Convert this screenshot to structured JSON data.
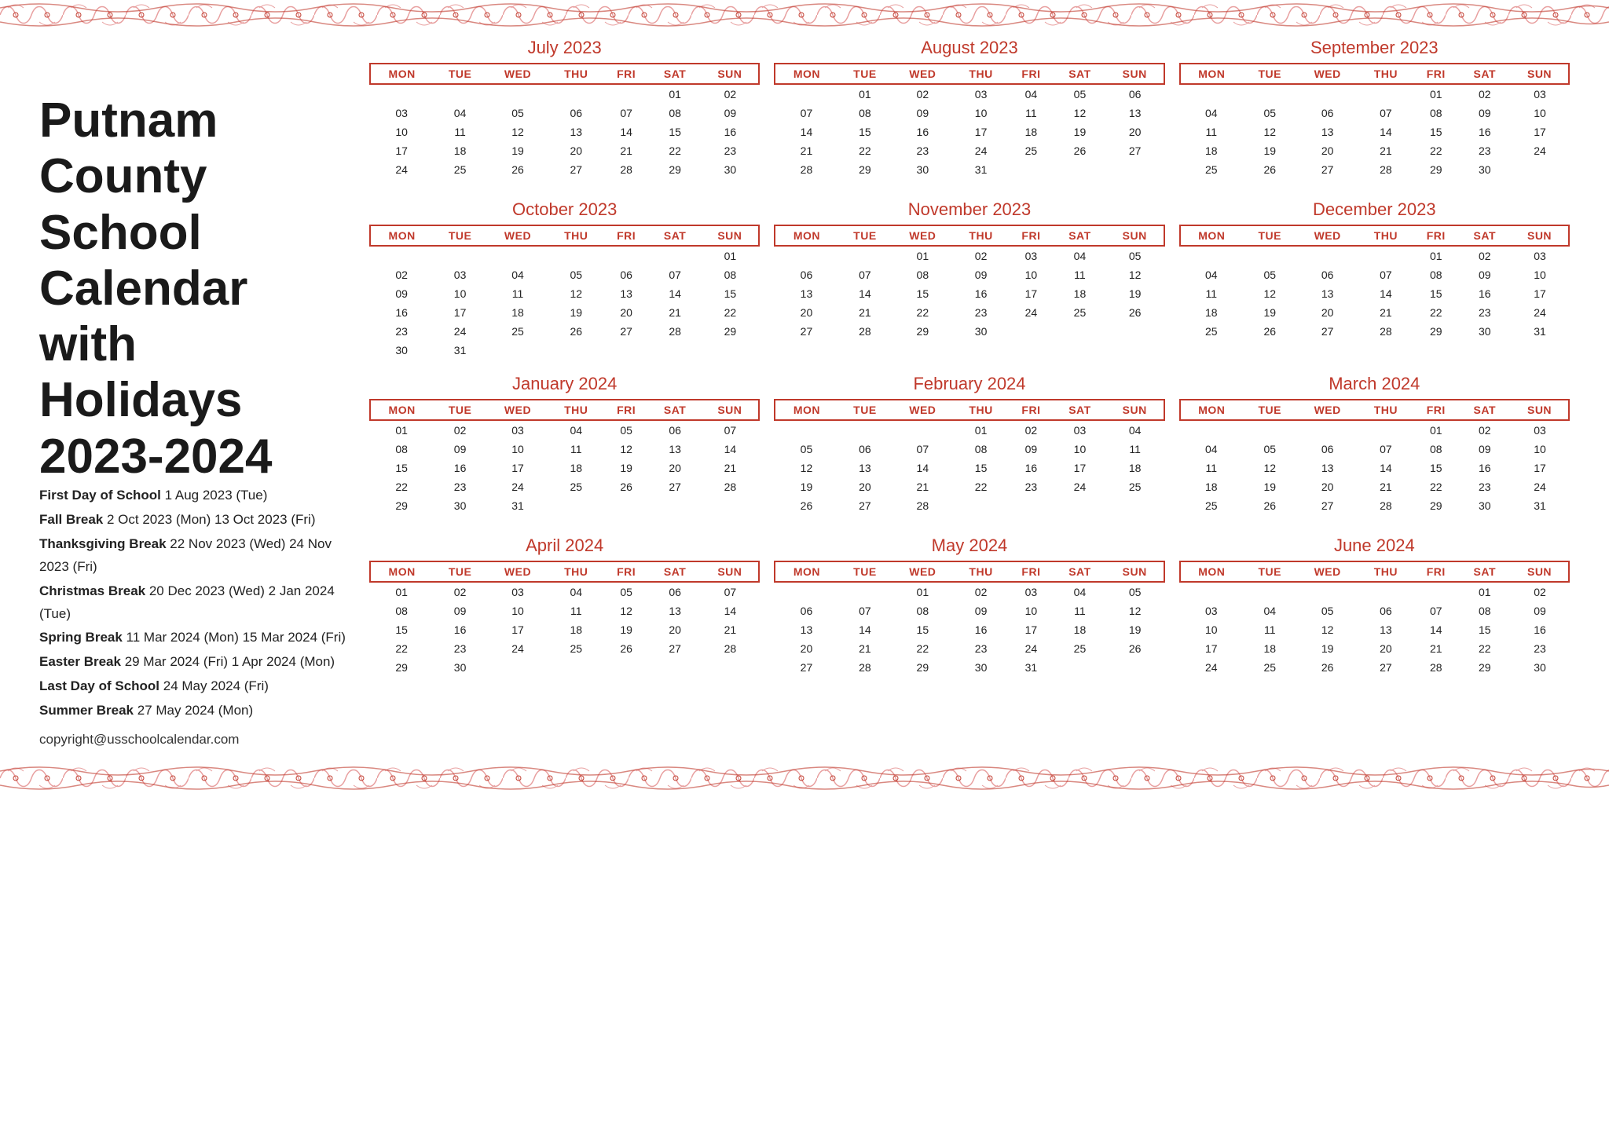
{
  "title": "Putnam County\nSchool Calendar\nwith Holidays\n2023-2024",
  "copyright": "copyright@usschoolcalendar.com",
  "holidays": [
    {
      "label": "First Day of School",
      "value": "1 Aug 2023 (Tue)"
    },
    {
      "label": "Fall Break",
      "value": "2 Oct 2023 (Mon)    13 Oct 2023 (Fri)"
    },
    {
      "label": "Thanksgiving Break",
      "value": "22 Nov 2023 (Wed) 24 Nov 2023 (Fri)"
    },
    {
      "label": "Christmas Break",
      "value": "20 Dec 2023 (Wed) 2 Jan 2024 (Tue)"
    },
    {
      "label": "Spring Break",
      "value": "11 Mar 2024 (Mon) 15 Mar 2024 (Fri)"
    },
    {
      "label": "Easter Break",
      "value": "29 Mar 2024 (Fri)    1 Apr 2024 (Mon)"
    },
    {
      "label": "Last Day of School",
      "value": "24 May 2024 (Fri)"
    },
    {
      "label": "Summer Break",
      "value": "27 May 2024 (Mon)"
    }
  ],
  "months": [
    {
      "name": "July 2023",
      "days": [
        "MON",
        "TUE",
        "WED",
        "THU",
        "FRI",
        "SAT",
        "SUN"
      ],
      "weeks": [
        [
          "",
          "",
          "",
          "",
          "",
          "01",
          "02"
        ],
        [
          "03",
          "04",
          "05",
          "06",
          "07",
          "08",
          "09"
        ],
        [
          "10",
          "11",
          "12",
          "13",
          "14",
          "15",
          "16"
        ],
        [
          "17",
          "18",
          "19",
          "20",
          "21",
          "22",
          "23"
        ],
        [
          "24",
          "25",
          "26",
          "27",
          "28",
          "29",
          "30"
        ],
        [
          "",
          "",
          "",
          "",
          "",
          "",
          ""
        ]
      ]
    },
    {
      "name": "August 2023",
      "days": [
        "MON",
        "TUE",
        "WED",
        "THU",
        "FRI",
        "SAT",
        "SUN"
      ],
      "weeks": [
        [
          "",
          "01",
          "02",
          "03",
          "04",
          "05",
          "06"
        ],
        [
          "07",
          "08",
          "09",
          "10",
          "11",
          "12",
          "13"
        ],
        [
          "14",
          "15",
          "16",
          "17",
          "18",
          "19",
          "20"
        ],
        [
          "21",
          "22",
          "23",
          "24",
          "25",
          "26",
          "27"
        ],
        [
          "28",
          "29",
          "30",
          "31",
          "",
          "",
          ""
        ],
        [
          "",
          "",
          "",
          "",
          "",
          "",
          ""
        ]
      ]
    },
    {
      "name": "September 2023",
      "days": [
        "MON",
        "TUE",
        "WED",
        "THU",
        "FRI",
        "SAT",
        "SUN"
      ],
      "weeks": [
        [
          "",
          "",
          "",
          "",
          "01",
          "02",
          "03"
        ],
        [
          "04",
          "05",
          "06",
          "07",
          "08",
          "09",
          "10"
        ],
        [
          "11",
          "12",
          "13",
          "14",
          "15",
          "16",
          "17"
        ],
        [
          "18",
          "19",
          "20",
          "21",
          "22",
          "23",
          "24"
        ],
        [
          "25",
          "26",
          "27",
          "28",
          "29",
          "30",
          ""
        ],
        [
          "",
          "",
          "",
          "",
          "",
          "",
          ""
        ]
      ]
    },
    {
      "name": "October 2023",
      "days": [
        "MON",
        "TUE",
        "WED",
        "THU",
        "FRI",
        "SAT",
        "SUN"
      ],
      "weeks": [
        [
          "",
          "",
          "",
          "",
          "",
          "",
          "01"
        ],
        [
          "02",
          "03",
          "04",
          "05",
          "06",
          "07",
          "08"
        ],
        [
          "09",
          "10",
          "11",
          "12",
          "13",
          "14",
          "15"
        ],
        [
          "16",
          "17",
          "18",
          "19",
          "20",
          "21",
          "22"
        ],
        [
          "23",
          "24",
          "25",
          "26",
          "27",
          "28",
          "29"
        ],
        [
          "30",
          "31",
          "",
          "",
          "",
          "",
          ""
        ]
      ]
    },
    {
      "name": "November 2023",
      "days": [
        "MON",
        "TUE",
        "WED",
        "THU",
        "FRI",
        "SAT",
        "SUN"
      ],
      "weeks": [
        [
          "",
          "",
          "01",
          "02",
          "03",
          "04",
          "05"
        ],
        [
          "06",
          "07",
          "08",
          "09",
          "10",
          "11",
          "12"
        ],
        [
          "13",
          "14",
          "15",
          "16",
          "17",
          "18",
          "19"
        ],
        [
          "20",
          "21",
          "22",
          "23",
          "24",
          "25",
          "26"
        ],
        [
          "27",
          "28",
          "29",
          "30",
          "",
          "",
          ""
        ],
        [
          "",
          "",
          "",
          "",
          "",
          "",
          ""
        ]
      ]
    },
    {
      "name": "December 2023",
      "days": [
        "MON",
        "TUE",
        "WED",
        "THU",
        "FRI",
        "SAT",
        "SUN"
      ],
      "weeks": [
        [
          "",
          "",
          "",
          "",
          "01",
          "02",
          "03"
        ],
        [
          "04",
          "05",
          "06",
          "07",
          "08",
          "09",
          "10"
        ],
        [
          "11",
          "12",
          "13",
          "14",
          "15",
          "16",
          "17"
        ],
        [
          "18",
          "19",
          "20",
          "21",
          "22",
          "23",
          "24"
        ],
        [
          "25",
          "26",
          "27",
          "28",
          "29",
          "30",
          "31"
        ],
        [
          "",
          "",
          "",
          "",
          "",
          "",
          ""
        ]
      ]
    },
    {
      "name": "January 2024",
      "days": [
        "MON",
        "TUE",
        "WED",
        "THU",
        "FRI",
        "SAT",
        "SUN"
      ],
      "weeks": [
        [
          "01",
          "02",
          "03",
          "04",
          "05",
          "06",
          "07"
        ],
        [
          "08",
          "09",
          "10",
          "11",
          "12",
          "13",
          "14"
        ],
        [
          "15",
          "16",
          "17",
          "18",
          "19",
          "20",
          "21"
        ],
        [
          "22",
          "23",
          "24",
          "25",
          "26",
          "27",
          "28"
        ],
        [
          "29",
          "30",
          "31",
          "",
          "",
          "",
          ""
        ],
        [
          "",
          "",
          "",
          "",
          "",
          "",
          ""
        ]
      ]
    },
    {
      "name": "February 2024",
      "days": [
        "MON",
        "TUE",
        "WED",
        "THU",
        "FRI",
        "SAT",
        "SUN"
      ],
      "weeks": [
        [
          "",
          "",
          "",
          "01",
          "02",
          "03",
          "04"
        ],
        [
          "05",
          "06",
          "07",
          "08",
          "09",
          "10",
          "11"
        ],
        [
          "12",
          "13",
          "14",
          "15",
          "16",
          "17",
          "18"
        ],
        [
          "19",
          "20",
          "21",
          "22",
          "23",
          "24",
          "25"
        ],
        [
          "26",
          "27",
          "28",
          "",
          "",
          "",
          ""
        ],
        [
          "",
          "",
          "",
          "",
          "",
          "",
          ""
        ]
      ]
    },
    {
      "name": "March 2024",
      "days": [
        "MON",
        "TUE",
        "WED",
        "THU",
        "FRI",
        "SAT",
        "SUN"
      ],
      "weeks": [
        [
          "",
          "",
          "",
          "",
          "01",
          "02",
          "03"
        ],
        [
          "04",
          "05",
          "06",
          "07",
          "08",
          "09",
          "10"
        ],
        [
          "11",
          "12",
          "13",
          "14",
          "15",
          "16",
          "17"
        ],
        [
          "18",
          "19",
          "20",
          "21",
          "22",
          "23",
          "24"
        ],
        [
          "25",
          "26",
          "27",
          "28",
          "29",
          "30",
          "31"
        ],
        [
          "",
          "",
          "",
          "",
          "",
          "",
          ""
        ]
      ]
    },
    {
      "name": "April 2024",
      "days": [
        "MON",
        "TUE",
        "WED",
        "THU",
        "FRI",
        "SAT",
        "SUN"
      ],
      "weeks": [
        [
          "01",
          "02",
          "03",
          "04",
          "05",
          "06",
          "07"
        ],
        [
          "08",
          "09",
          "10",
          "11",
          "12",
          "13",
          "14"
        ],
        [
          "15",
          "16",
          "17",
          "18",
          "19",
          "20",
          "21"
        ],
        [
          "22",
          "23",
          "24",
          "25",
          "26",
          "27",
          "28"
        ],
        [
          "29",
          "30",
          "",
          "",
          "",
          "",
          ""
        ],
        [
          "",
          "",
          "",
          "",
          "",
          "",
          ""
        ]
      ]
    },
    {
      "name": "May 2024",
      "days": [
        "MON",
        "TUE",
        "WED",
        "THU",
        "FRI",
        "SAT",
        "SUN"
      ],
      "weeks": [
        [
          "",
          "",
          "01",
          "02",
          "03",
          "04",
          "05"
        ],
        [
          "06",
          "07",
          "08",
          "09",
          "10",
          "11",
          "12"
        ],
        [
          "13",
          "14",
          "15",
          "16",
          "17",
          "18",
          "19"
        ],
        [
          "20",
          "21",
          "22",
          "23",
          "24",
          "25",
          "26"
        ],
        [
          "27",
          "28",
          "29",
          "30",
          "31",
          "",
          ""
        ],
        [
          "",
          "",
          "",
          "",
          "",
          "",
          ""
        ]
      ]
    },
    {
      "name": "June 2024",
      "days": [
        "MON",
        "TUE",
        "WED",
        "THU",
        "FRI",
        "SAT",
        "SUN"
      ],
      "weeks": [
        [
          "",
          "",
          "",
          "",
          "",
          "01",
          "02"
        ],
        [
          "03",
          "04",
          "05",
          "06",
          "07",
          "08",
          "09"
        ],
        [
          "10",
          "11",
          "12",
          "13",
          "14",
          "15",
          "16"
        ],
        [
          "17",
          "18",
          "19",
          "20",
          "21",
          "22",
          "23"
        ],
        [
          "24",
          "25",
          "26",
          "27",
          "28",
          "29",
          "30"
        ],
        [
          "",
          "",
          "",
          "",
          "",
          "",
          ""
        ]
      ]
    }
  ]
}
